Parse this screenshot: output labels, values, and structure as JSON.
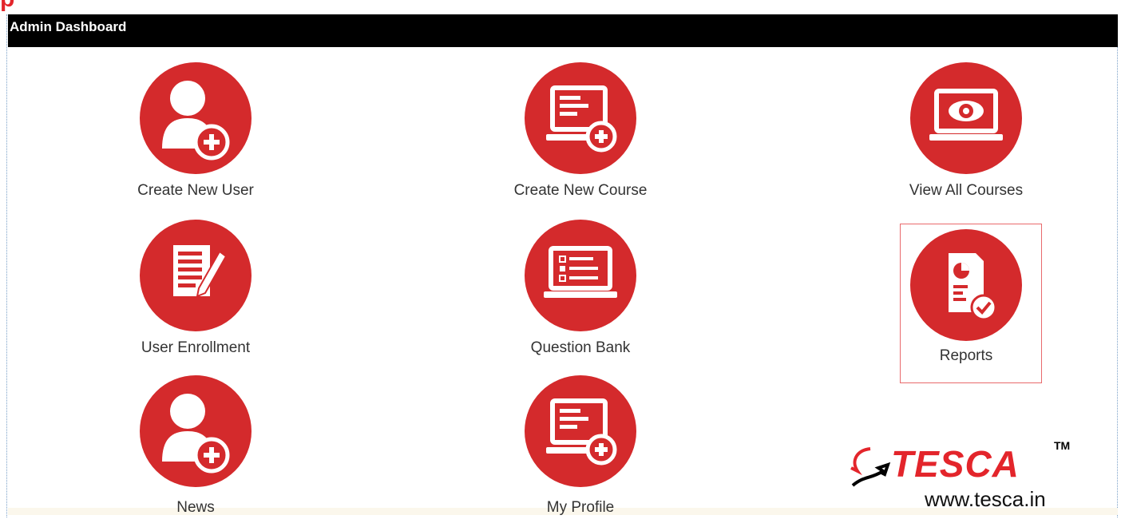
{
  "header": {
    "title": "Admin Dashboard"
  },
  "tiles": [
    {
      "label": "Create New User",
      "icon": "user-add-icon"
    },
    {
      "label": "Create New Course",
      "icon": "laptop-add-icon"
    },
    {
      "label": "View All Courses",
      "icon": "laptop-eye-icon"
    },
    {
      "label": "User Enrollment",
      "icon": "document-edit-icon"
    },
    {
      "label": "Question Bank",
      "icon": "laptop-checklist-icon"
    },
    {
      "label": "Reports",
      "icon": "report-check-icon",
      "selected": true
    },
    {
      "label": "News",
      "icon": "user-add-icon"
    },
    {
      "label": "My Profile",
      "icon": "laptop-add-icon"
    }
  ],
  "watermark": {
    "brand": "TESCA",
    "tm": "TM",
    "url": "www.tesca.in"
  },
  "colors": {
    "accent": "#d42a2c",
    "header_bg": "#000000",
    "selection": "#e96a6c"
  }
}
